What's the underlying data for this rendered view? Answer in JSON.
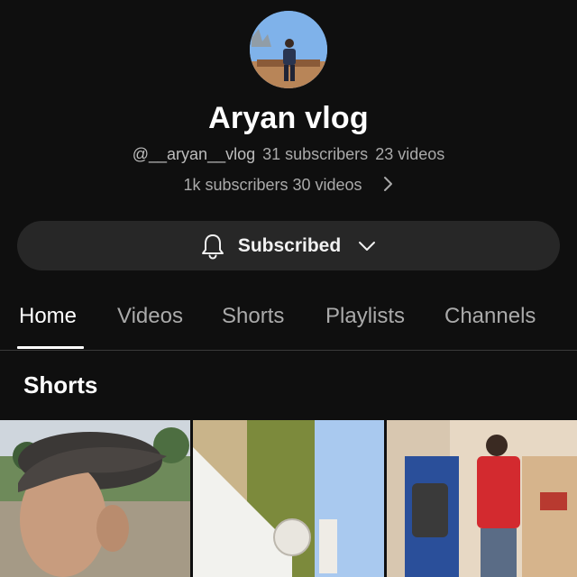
{
  "channel": {
    "name": "Aryan vlog",
    "handle": "@__aryan__vlog",
    "subscribers": "31 subscribers",
    "videos": "23 videos",
    "more_info": "1k subscribers 30 videos"
  },
  "subscribe_button": {
    "label": "Subscribed",
    "icon": "bell-icon",
    "caret_icon": "chevron-down-icon"
  },
  "tabs": [
    {
      "label": "Home",
      "active": true
    },
    {
      "label": "Videos"
    },
    {
      "label": "Shorts"
    },
    {
      "label": "Playlists"
    },
    {
      "label": "Channels"
    }
  ],
  "section": {
    "title": "Shorts"
  },
  "colors": {
    "background": "#0f0f0f",
    "button_bg": "#272727",
    "secondary_text": "#aaaaaa",
    "primary_text": "#ffffff"
  }
}
